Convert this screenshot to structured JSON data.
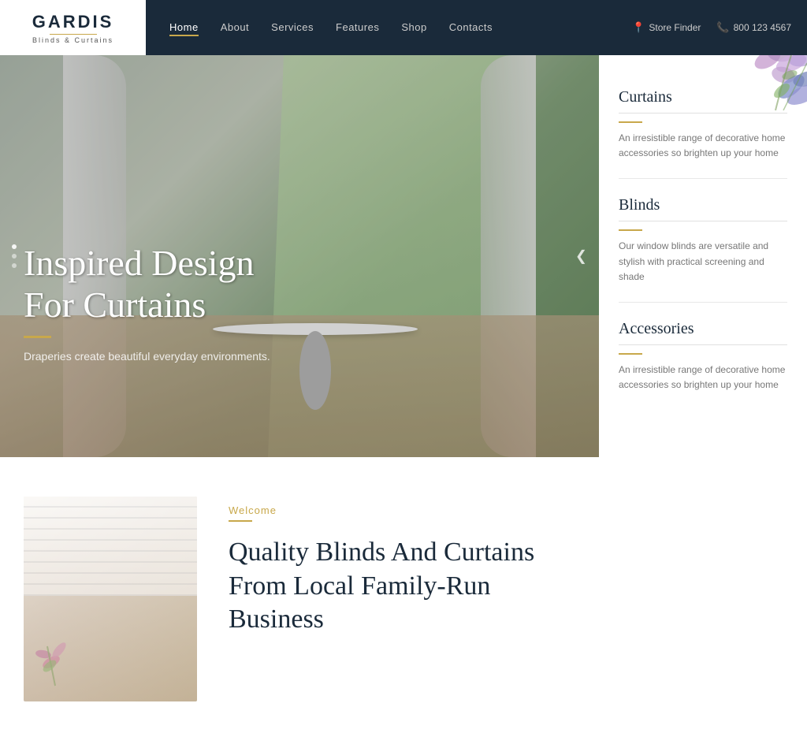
{
  "brand": {
    "name": "GARDIS",
    "sub": "Blinds & Curtains",
    "logo_line_color": "#c8a84b"
  },
  "navbar": {
    "links": [
      {
        "label": "Home",
        "active": true
      },
      {
        "label": "About",
        "active": false
      },
      {
        "label": "Services",
        "active": false
      },
      {
        "label": "Features",
        "active": false
      },
      {
        "label": "Shop",
        "active": false
      },
      {
        "label": "Contacts",
        "active": false
      }
    ],
    "store_finder": "Store Finder",
    "phone": "800 123 4567"
  },
  "hero": {
    "title": "Inspired Design\nFor Curtains",
    "subtitle": "Draperies create beautiful everyday environments.",
    "accent_color": "#c8a84b"
  },
  "sidebar": {
    "items": [
      {
        "title": "Curtains",
        "description": "An irresistible range of decorative home accessories so brighten up your home"
      },
      {
        "title": "Blinds",
        "description": "Our window blinds are versatile and stylish with practical screening and shade"
      },
      {
        "title": "Accessories",
        "description": "An irresistible range of decorative home accessories so brighten up your home"
      }
    ]
  },
  "welcome_section": {
    "label": "Welcome",
    "heading_line1": "Quality Blinds And Curtains",
    "heading_line2": "From Local Family-Run",
    "heading_line3": "Business"
  },
  "dots": [
    "",
    "",
    ""
  ],
  "colors": {
    "navy": "#1a2a3a",
    "gold": "#c8a84b",
    "light_gray": "#e8e8e8"
  }
}
